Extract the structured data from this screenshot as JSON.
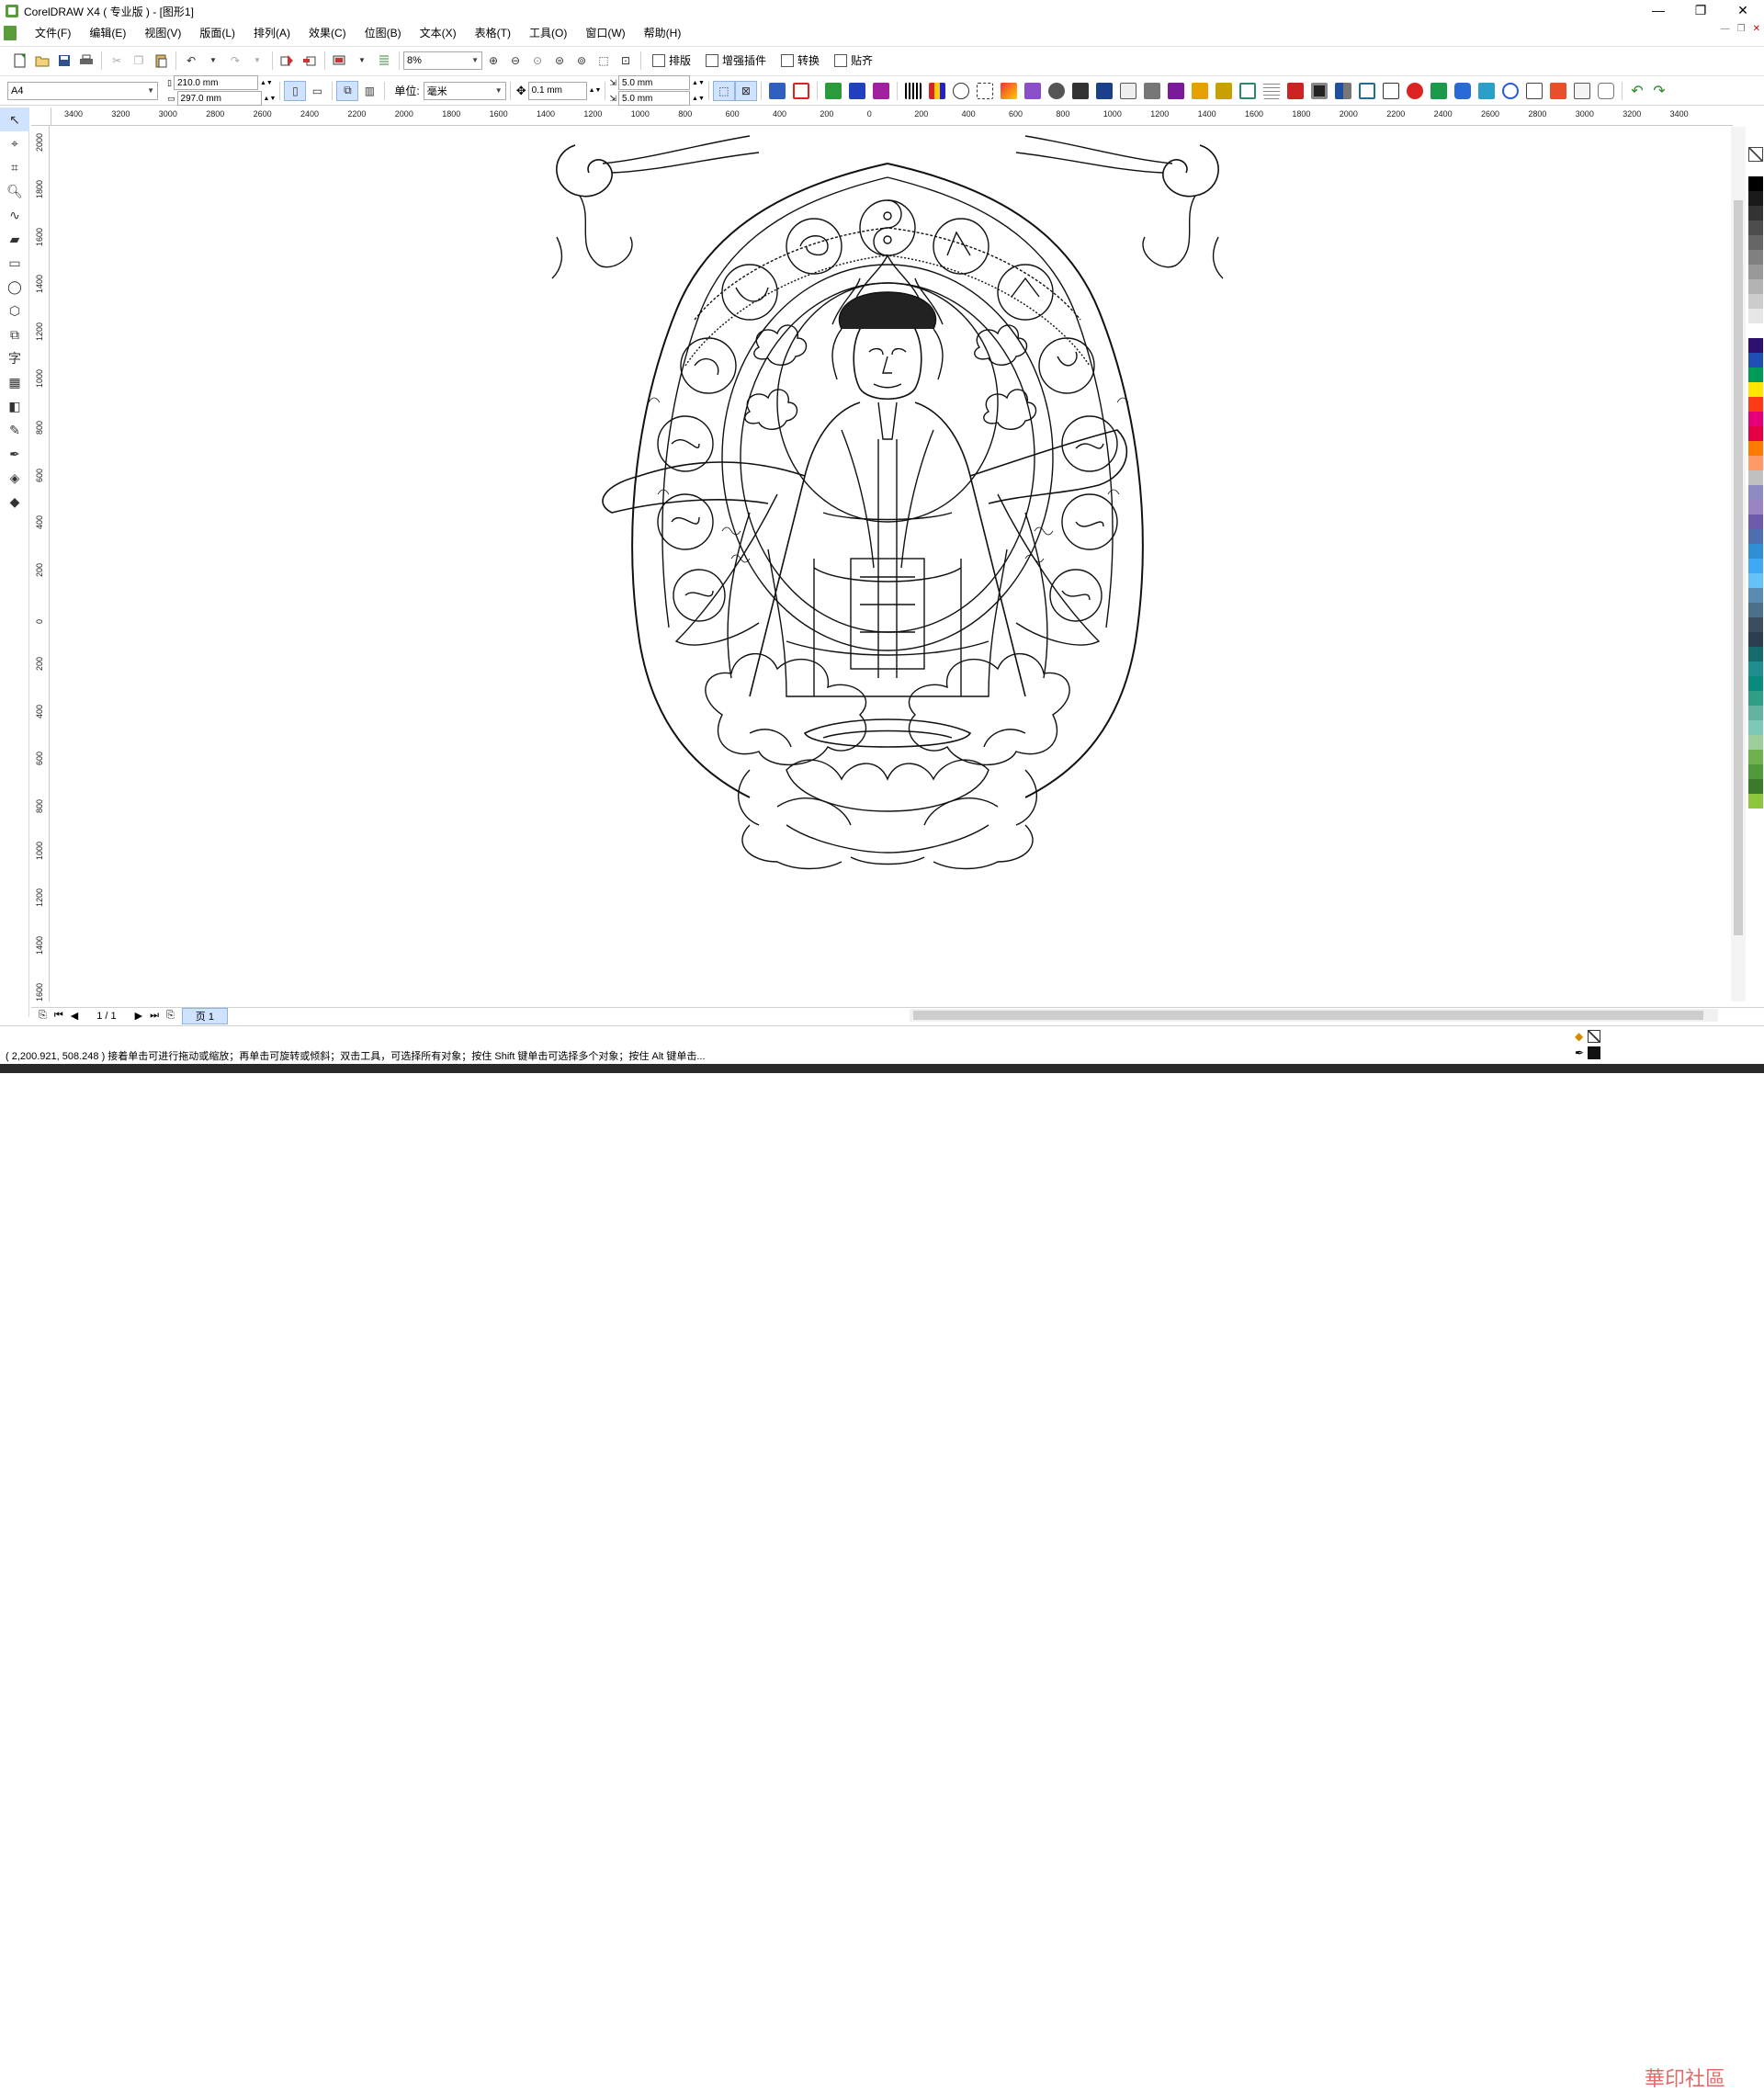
{
  "window": {
    "title": "CorelDRAW X4 ( 专业版 ) - [图形1]",
    "controls": [
      "—",
      "❐",
      "✕"
    ]
  },
  "menu": [
    "文件(F)",
    "编辑(E)",
    "视图(V)",
    "版面(L)",
    "排列(A)",
    "效果(C)",
    "位图(B)",
    "文本(X)",
    "表格(T)",
    "工具(O)",
    "窗口(W)",
    "帮助(H)"
  ],
  "toolbar": {
    "zoom": "8%",
    "plugins": [
      "排版",
      "增强插件",
      "转换",
      "贴齐"
    ]
  },
  "property_bar": {
    "page_size": "A4",
    "width": "210.0 mm",
    "height": "297.0 mm",
    "unit_label": "单位:",
    "unit": "毫米",
    "nudge": "0.1 mm",
    "dup_x": "5.0 mm",
    "dup_y": "5.0 mm"
  },
  "ruler": {
    "h_ticks": [
      "3400",
      "3200",
      "3000",
      "2800",
      "2600",
      "2400",
      "2200",
      "2000",
      "1800",
      "1600",
      "1400",
      "1200",
      "1000",
      "800",
      "600",
      "400",
      "200",
      "0",
      "200",
      "400",
      "600",
      "800",
      "1000",
      "1200",
      "1400",
      "1600",
      "1800",
      "2000",
      "2200",
      "2400",
      "2600",
      "2800",
      "3000",
      "3200",
      "3400"
    ],
    "v_ticks": [
      "2000",
      "1800",
      "1600",
      "1400",
      "1200",
      "1000",
      "800",
      "600",
      "400",
      "200",
      "0",
      "200",
      "400",
      "600",
      "800",
      "1000",
      "1200",
      "1400",
      "1600"
    ]
  },
  "navigator": {
    "page_counter": "1 / 1",
    "page_tab": "页 1"
  },
  "status": {
    "text": "( 2,200.921, 508.248 ) 接着单击可进行拖动或缩放；再单击可旋转或倾斜；双击工具，可选择所有对象；按住 Shift 键单击可选择多个对象；按住 Alt 键单击..."
  },
  "watermark": "華印社區",
  "colors": {
    "palette": [
      "#ffffff",
      "#000000",
      "#1a1a1a",
      "#333333",
      "#4d4d4d",
      "#666666",
      "#808080",
      "#999999",
      "#b3b3b3",
      "#cccccc",
      "#e6e6e6",
      "#ffffff",
      "#2e0f6e",
      "#1f4fb4",
      "#009a57",
      "#ffe500",
      "#ff3a14",
      "#e5007a",
      "#e50043",
      "#ff7a00",
      "#ff9966",
      "#c0c0c0",
      "#8e8ac4",
      "#9b84c4",
      "#6d5aa8",
      "#4d6fb0",
      "#2d8fd5",
      "#3fa9f5",
      "#63c2f6",
      "#5a8bb2",
      "#4c6f8a",
      "#3a4e5f",
      "#2c3e50",
      "#176b6b",
      "#1e8e8e",
      "#0a8a7a",
      "#2e9f84",
      "#63b3a0",
      "#7ec8b8",
      "#9ccf9a",
      "#6fb04e",
      "#4f9a3a",
      "#3a7a2a",
      "#8dc63f"
    ]
  }
}
